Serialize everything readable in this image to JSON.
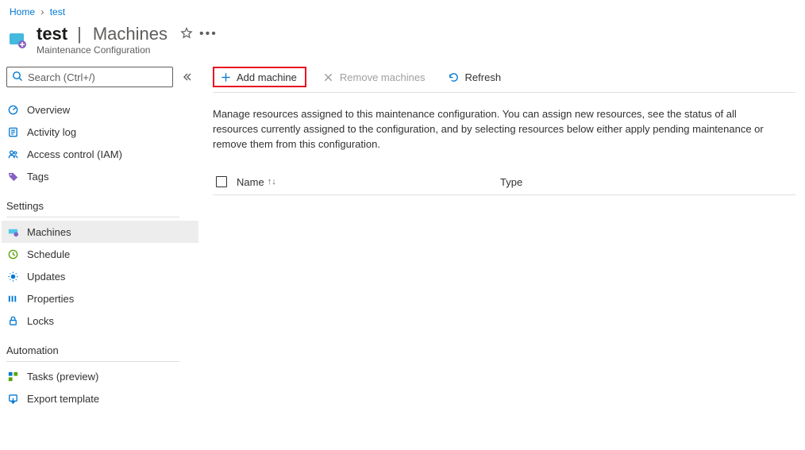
{
  "breadcrumb": {
    "home": "Home",
    "current": "test"
  },
  "header": {
    "resource_name": "test",
    "section": "Machines",
    "subtitle": "Maintenance Configuration"
  },
  "sidebar": {
    "search_placeholder": "Search (Ctrl+/)",
    "items": [
      {
        "label": "Overview"
      },
      {
        "label": "Activity log"
      },
      {
        "label": "Access control (IAM)"
      },
      {
        "label": "Tags"
      }
    ],
    "group_settings": "Settings",
    "settings_items": [
      {
        "label": "Machines"
      },
      {
        "label": "Schedule"
      },
      {
        "label": "Updates"
      },
      {
        "label": "Properties"
      },
      {
        "label": "Locks"
      }
    ],
    "group_automation": "Automation",
    "automation_items": [
      {
        "label": "Tasks (preview)"
      },
      {
        "label": "Export template"
      }
    ]
  },
  "toolbar": {
    "add_machine": "Add machine",
    "remove_machines": "Remove machines",
    "refresh": "Refresh"
  },
  "main": {
    "description": "Manage resources assigned to this maintenance configuration. You can assign new resources, see the status of all resources currently assigned to the configuration, and by selecting resources below either apply pending maintenance or remove them from this configuration.",
    "col_name": "Name",
    "col_type": "Type"
  }
}
